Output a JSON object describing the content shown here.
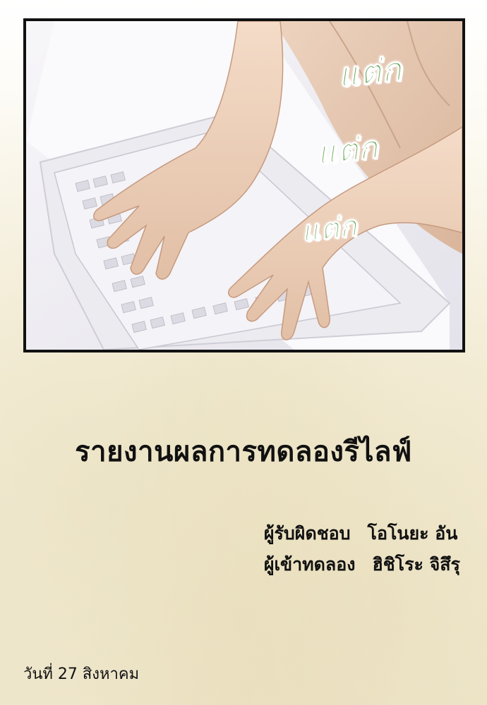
{
  "panel": {
    "sfx": [
      "แต่ก",
      "แต่ก",
      "แต่ก"
    ]
  },
  "report": {
    "title": "รายงานผลการทดลองรีไลฟ์",
    "supervisor_role": "ผู้รับผิดชอบ",
    "supervisor_name": "โอโนยะ อัน",
    "subject_role": "ผู้เข้าทดลอง",
    "subject_name": "ฮิชิโระ จิสึรุ",
    "date": "วันที่ 27 สิงหาคม"
  },
  "colors": {
    "sfx_green": "#6aa85a",
    "border": "#111111",
    "paper": "#f6f0dc"
  }
}
